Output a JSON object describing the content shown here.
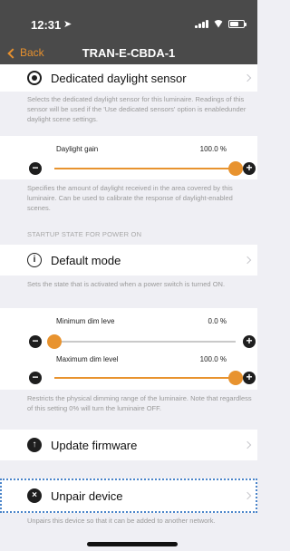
{
  "status_bar": {
    "time": "12:31"
  },
  "nav": {
    "back_label": "Back",
    "title": "TRAN-E-CBDA-1"
  },
  "sensor": {
    "label": "Dedicated daylight sensor",
    "description": "Selects the dedicated daylight sensor for this luminaire. Readings of this sensor will be used if the 'Use dedicated sensors' option is enabledunder daylight scene settings."
  },
  "daylight_gain": {
    "label": "Daylight gain",
    "value_text": "100.0 %",
    "value": 100,
    "description": "Specifies the amount of daylight received in the area covered by this luminaire. Can be used to calibrate the response of daylight-enabled scenes."
  },
  "startup_section": "STARTUP STATE FOR POWER ON",
  "default_mode": {
    "label": "Default mode",
    "description": "Sets the state that is activated when a power switch is turned ON."
  },
  "min_dim": {
    "label": "Minimum dim leve",
    "value_text": "0.0 %",
    "value": 0
  },
  "max_dim": {
    "label": "Maximum dim level",
    "value_text": "100.0 %",
    "value": 100,
    "description": "Restricts the physical dimming range of the luminaire. Note that regardless of this setting 0% will turn the luminaire OFF."
  },
  "firmware": {
    "label": "Update firmware"
  },
  "unpair": {
    "label": "Unpair device",
    "description": "Unpairs this device so that it can be added to another network."
  },
  "icons": {
    "radio": "radio-selected-icon",
    "info": "info-icon",
    "upload": "upload-arrow-icon",
    "close": "close-circle-icon",
    "back": "chevron-left-icon"
  },
  "colors": {
    "accent": "#e8932f",
    "header": "#4a4a4a",
    "focus_outline": "#4a84c9"
  }
}
